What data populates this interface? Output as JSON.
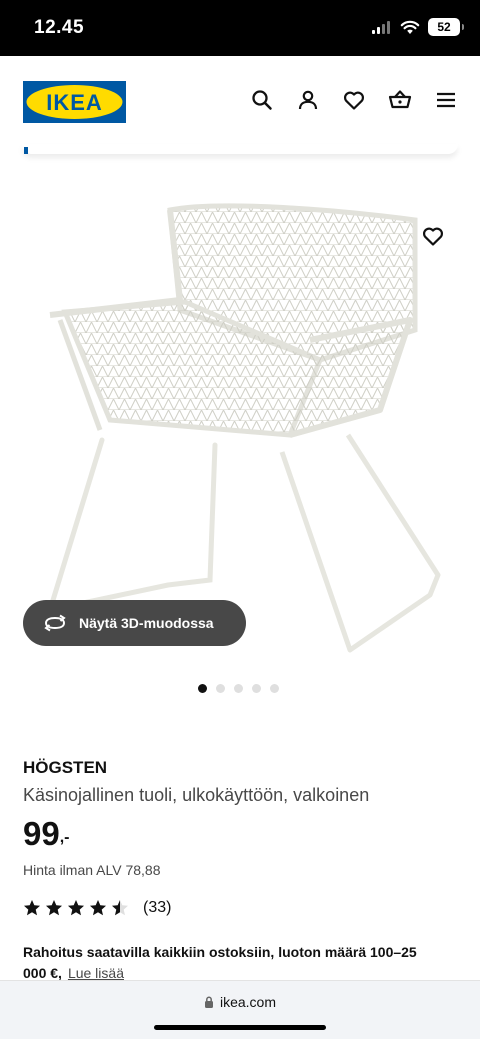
{
  "status_bar": {
    "time": "12.45",
    "battery": "52"
  },
  "header": {
    "logo_text": "IKEA",
    "icons": [
      "search-icon",
      "user-icon",
      "heart-icon",
      "basket-icon",
      "menu-icon"
    ],
    "colors": {
      "brand_blue": "#0058a3",
      "brand_yellow": "#ffdb00"
    }
  },
  "gallery": {
    "view_3d_label": "Näytä 3D-muodossa",
    "image_count": 5,
    "active_index": 0
  },
  "product": {
    "name": "HÖGSTEN",
    "description": "Käsinojallinen tuoli, ulkokäyttöön, valkoinen",
    "price": "99",
    "price_suffix": ",-",
    "vat_text": "Hinta ilman ALV 78,88",
    "rating": 4.5,
    "rating_max": 5,
    "review_count": "(33)",
    "financing_text": "Rahoitus saatavilla kaikkiin ostoksiin, luoton määrä 100–25 000 €,",
    "financing_link": "Lue lisää"
  },
  "browser": {
    "url": "ikea.com"
  }
}
